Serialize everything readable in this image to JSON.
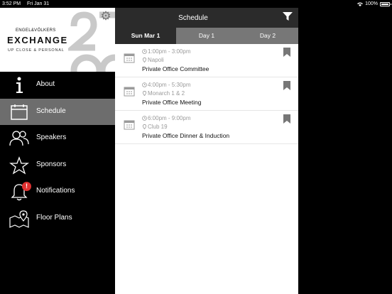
{
  "status": {
    "time": "3:52 PM",
    "date": "Fri Jan 31",
    "battery": "100%"
  },
  "logo": {
    "brand": "ENGEL&VÖLKERS",
    "title": "EXCHANGE",
    "subtitle": "UP CLOSE & PERSONAL"
  },
  "nav": {
    "items": [
      {
        "label": "About"
      },
      {
        "label": "Schedule"
      },
      {
        "label": "Speakers"
      },
      {
        "label": "Sponsors"
      },
      {
        "label": "Notifications",
        "badge": "!"
      },
      {
        "label": "Floor Plans"
      }
    ]
  },
  "header": {
    "title": "Schedule"
  },
  "tabs": [
    {
      "label": "Sun Mar 1"
    },
    {
      "label": "Day 1"
    },
    {
      "label": "Day 2"
    }
  ],
  "events": [
    {
      "time": "1:00pm - 3:00pm",
      "location": "Napoli",
      "title": "Private Office Committee"
    },
    {
      "time": "4:00pm - 5:30pm",
      "location": "Monarch 1 & 2",
      "title": "Private Office Meeting"
    },
    {
      "time": "6:00pm - 9:00pm",
      "location": "Club 19",
      "title": "Private Office Dinner & Induction"
    }
  ],
  "colors": {
    "active_nav": "#6d6d6d",
    "header": "#2b2b2b",
    "tab_inactive": "#777777",
    "badge": "#e03131"
  }
}
